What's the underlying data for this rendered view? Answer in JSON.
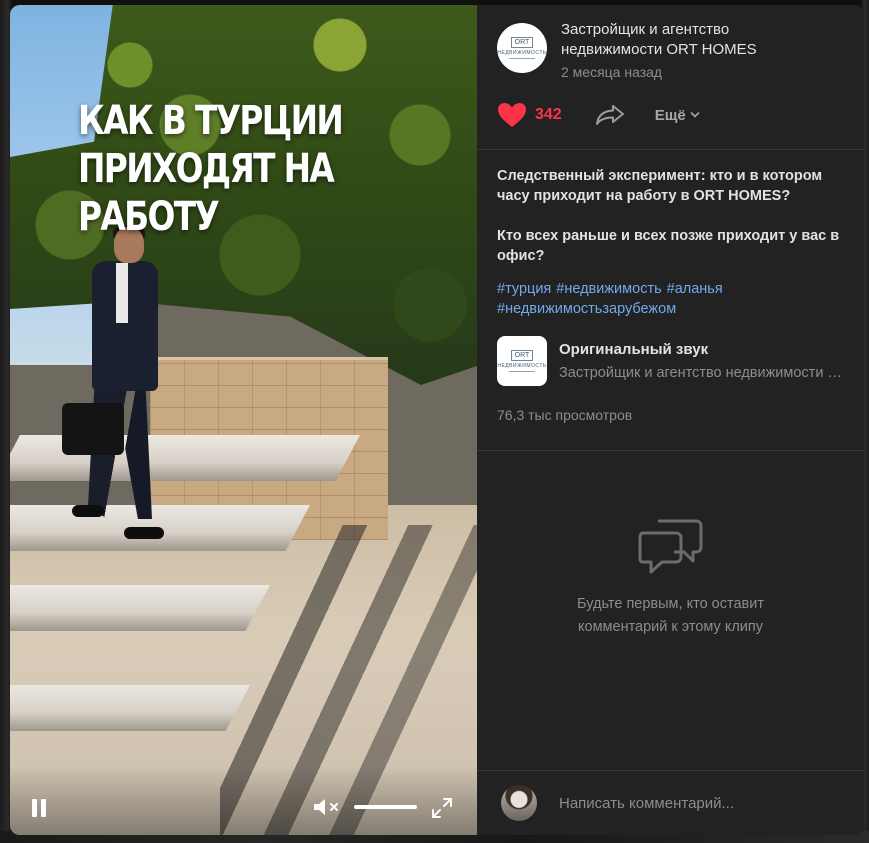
{
  "video": {
    "title_line1": "КАК В ТУРЦИИ",
    "title_line2": "ПРИХОДЯТ НА РАБОТУ",
    "volume_level": 1.0,
    "controls": {
      "pause_icon": "pause-icon",
      "mute_icon": "volume-muted-icon",
      "fullscreen_icon": "fullscreen-icon"
    }
  },
  "author": {
    "name": "Застройщик и агентство недвижимости ORT HOMES",
    "time": "2 месяца назад",
    "logo_text_top": "ORT",
    "logo_text_bottom": "НЕДВИЖИМОСТЬ"
  },
  "actions": {
    "like_count": "342",
    "more_label": "Ещё",
    "like_color": "#ff3347"
  },
  "description": {
    "paragraph1": "Следственный эксперимент: кто и в котором часу приходит на работу в ORT HOMES?",
    "paragraph2": "Кто всех раньше и всех позже приходит у вас в офис?",
    "tags": [
      "#турция",
      "#недвижимость",
      "#аланья",
      "#недвижимостьзарубежом"
    ]
  },
  "audio": {
    "title": "Оригинальный звук",
    "subtitle": "Застройщик и агентство недвижимости ORT HOMES"
  },
  "views": "76,3 тыс просмотров",
  "comments": {
    "empty_line1": "Будьте первым, кто оставит",
    "empty_line2": "комментарий к этому клипу",
    "input_placeholder": "Написать комментарий..."
  },
  "colors": {
    "accent_link": "#71aaeb",
    "panel_bg": "#222222",
    "muted_text": "#8a8d91"
  }
}
